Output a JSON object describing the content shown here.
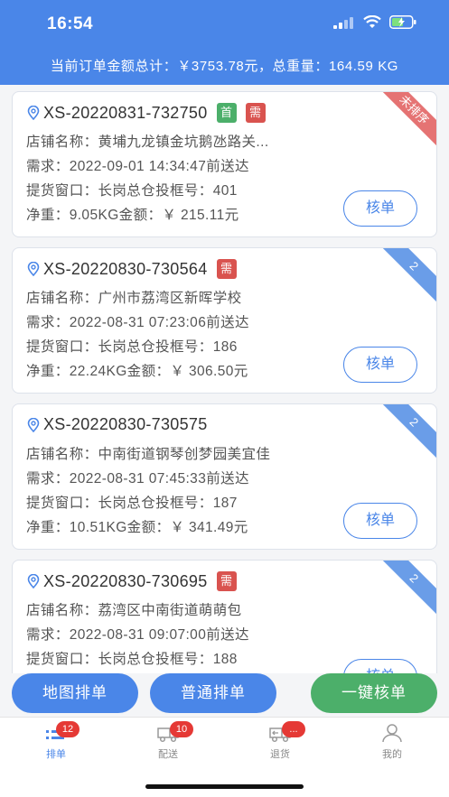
{
  "status_bar": {
    "time": "16:54"
  },
  "summary": "当前订单金额总计：￥3753.78元，总重量：164.59 KG",
  "orders": [
    {
      "order_no": "XS-20220831-732750",
      "tags": [
        {
          "label": "首",
          "color": "#4caf6a"
        },
        {
          "label": "需",
          "color": "#d9534f"
        }
      ],
      "ribbon": "未排序",
      "shop": "店铺名称：黄埔九龙镇金坑鹅氹路关...",
      "deadline": "需求：2022-09-01 14:34:47前送达",
      "window": "提货窗口：长岗总仓投框号：401",
      "weight_amount": "净重：9.05KG金额：￥ 215.11元",
      "button": "核单"
    },
    {
      "order_no": "XS-20220830-730564",
      "tags": [
        {
          "label": "需",
          "color": "#d9534f"
        }
      ],
      "ribbon": "2",
      "shop": "店铺名称：广州市荔湾区新晖学校",
      "deadline": "需求：2022-08-31 07:23:06前送达",
      "window": "提货窗口：长岗总仓投框号：186",
      "weight_amount": "净重：22.24KG金额：￥ 306.50元",
      "button": "核单"
    },
    {
      "order_no": "XS-20220830-730575",
      "tags": [],
      "ribbon": "2",
      "shop": "店铺名称：中南街道钢琴创梦园美宜佳",
      "deadline": "需求：2022-08-31 07:45:33前送达",
      "window": "提货窗口：长岗总仓投框号：187",
      "weight_amount": "净重：10.51KG金额：￥ 341.49元",
      "button": "核单"
    },
    {
      "order_no": "XS-20220830-730695",
      "tags": [
        {
          "label": "需",
          "color": "#d9534f"
        }
      ],
      "ribbon": "2",
      "shop": "店铺名称：荔湾区中南街道萌萌包",
      "deadline": "需求：2022-08-31 09:07:00前送达",
      "window": "提货窗口：长岗总仓投框号：188",
      "weight_amount": "",
      "button": "核单"
    }
  ],
  "actions": {
    "map_sort": "地图排单",
    "normal_sort": "普通排单",
    "one_click_verify": "一键核单"
  },
  "tabs": [
    {
      "label": "排单",
      "badge": "12",
      "icon": "list-icon",
      "active": true
    },
    {
      "label": "配送",
      "badge": "10",
      "icon": "truck-icon",
      "active": false
    },
    {
      "label": "退货",
      "badge": "...",
      "icon": "return-truck-icon",
      "active": false
    },
    {
      "label": "我的",
      "badge": "",
      "icon": "user-icon",
      "active": false
    }
  ],
  "colors": {
    "primary": "#4a86e8",
    "green": "#4caf6a",
    "red": "#d9534f",
    "badge": "#e53935"
  }
}
